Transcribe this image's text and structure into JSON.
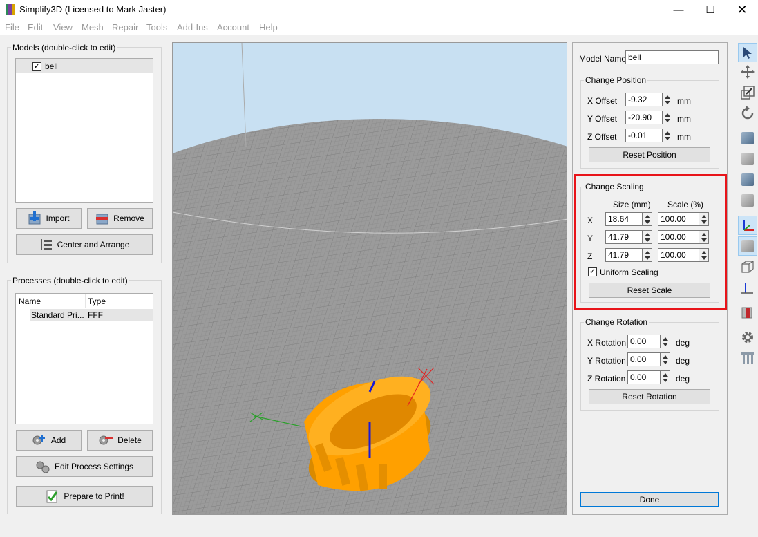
{
  "window": {
    "title": "Simplify3D (Licensed to Mark Jaster)",
    "minimize_icon": "minimize-icon",
    "maximize_icon": "maximize-icon",
    "close_icon": "close-icon"
  },
  "menu": [
    "File",
    "Edit",
    "View",
    "Mesh",
    "Repair",
    "Tools",
    "Add-Ins",
    "Account",
    "Help"
  ],
  "models": {
    "group_title": "Models (double-click to edit)",
    "items": [
      {
        "name": "bell",
        "checked": true
      }
    ],
    "import_label": "Import",
    "remove_label": "Remove",
    "center_label": "Center and Arrange"
  },
  "processes": {
    "group_title": "Processes (double-click to edit)",
    "columns": [
      "Name",
      "Type"
    ],
    "rows": [
      {
        "name": "Standard Pri...",
        "type": "FFF"
      }
    ],
    "add_label": "Add",
    "delete_label": "Delete",
    "edit_label": "Edit Process Settings",
    "prepare_label": "Prepare to Print!"
  },
  "panel": {
    "model_name_label": "Model Name:",
    "model_name_value": "bell",
    "position": {
      "title": "Change Position",
      "x_label": "X Offset",
      "x_value": "-9.32",
      "y_label": "Y Offset",
      "y_value": "-20.90",
      "z_label": "Z Offset",
      "z_value": "-0.01",
      "unit": "mm",
      "reset_label": "Reset Position"
    },
    "scaling": {
      "title": "Change Scaling",
      "size_header": "Size (mm)",
      "scale_header": "Scale (%)",
      "rows": [
        {
          "axis": "X",
          "size": "18.64",
          "scale": "100.00"
        },
        {
          "axis": "Y",
          "size": "41.79",
          "scale": "100.00"
        },
        {
          "axis": "Z",
          "size": "41.79",
          "scale": "100.00"
        }
      ],
      "uniform_label": "Uniform Scaling",
      "uniform_checked": true,
      "reset_label": "Reset Scale",
      "highlight_color": "#e8141a"
    },
    "rotation": {
      "title": "Change Rotation",
      "x_label": "X Rotation",
      "x_value": "0.00",
      "y_label": "Y Rotation",
      "y_value": "0.00",
      "z_label": "Z Rotation",
      "z_value": "0.00",
      "unit": "deg",
      "reset_label": "Reset Rotation"
    },
    "done_label": "Done"
  },
  "toolbar": {
    "icons": [
      "select-arrow-icon",
      "move-icon",
      "scale-icon",
      "rotate-icon",
      "view-top-cube-icon",
      "view-front-cube-icon",
      "view-side-cube-icon",
      "view-bottom-cube-icon",
      "axes-icon",
      "solid-view-icon",
      "wireframe-view-icon",
      "align-axis-icon",
      "cross-section-icon",
      "settings-gear-icon",
      "supports-icon"
    ]
  },
  "colors": {
    "model": "#ffa000",
    "bed": "#9a9a9a",
    "sky": "#c8e0f2",
    "accent": "#0078d7"
  }
}
